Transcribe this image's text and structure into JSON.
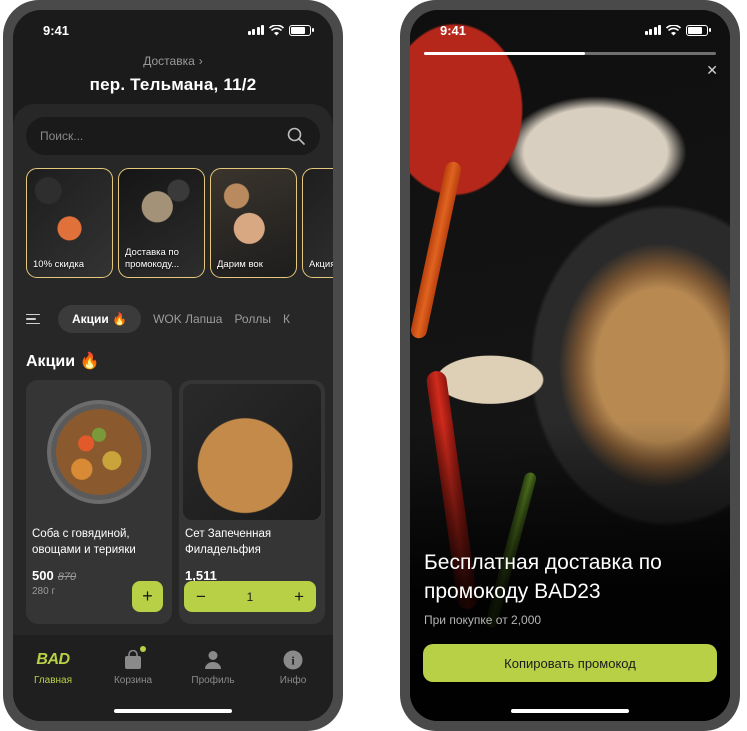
{
  "colors": {
    "accent": "#b8d046",
    "story_border": "#e5c87c",
    "background": "#1b1b1b",
    "panel": "#272727",
    "card": "#353535"
  },
  "menu_screen": {
    "status_time": "9:41",
    "delivery_label": "Доставка",
    "address": "пер. Тельмана, 11/2",
    "search_placeholder": "Поиск...",
    "stories": [
      {
        "text": "10% скидка"
      },
      {
        "text": "Доставка по промокоду..."
      },
      {
        "text": "Дарим вок"
      },
      {
        "text": "Акция!"
      }
    ],
    "tabs": [
      "Акции 🔥",
      "WOK Лапша",
      "Роллы",
      "К"
    ],
    "section_title": "Акции 🔥",
    "products": [
      {
        "name": "Соба с говядиной, овощами и терияки",
        "price": "500",
        "old_price": "870",
        "weight": "280 г",
        "add_label": "+"
      },
      {
        "name": "Сет Запеченная Филадельфия",
        "price": "1,511",
        "quantity": "1",
        "minus_label": "−",
        "plus_label": "+"
      }
    ],
    "nav": [
      {
        "label": "Главная",
        "icon": "logo-icon",
        "logo_text": "BAD"
      },
      {
        "label": "Корзина",
        "icon": "cart-icon"
      },
      {
        "label": "Профиль",
        "icon": "profile-icon"
      },
      {
        "label": "Инфо",
        "icon": "info-icon",
        "glyph": "i"
      }
    ]
  },
  "promo_screen": {
    "status_time": "9:41",
    "story_progress": 0.55,
    "title": "Бесплатная доставка по промокоду BAD23",
    "subtitle": "При покупке от 2,000",
    "button_label": "Копировать промокод"
  }
}
